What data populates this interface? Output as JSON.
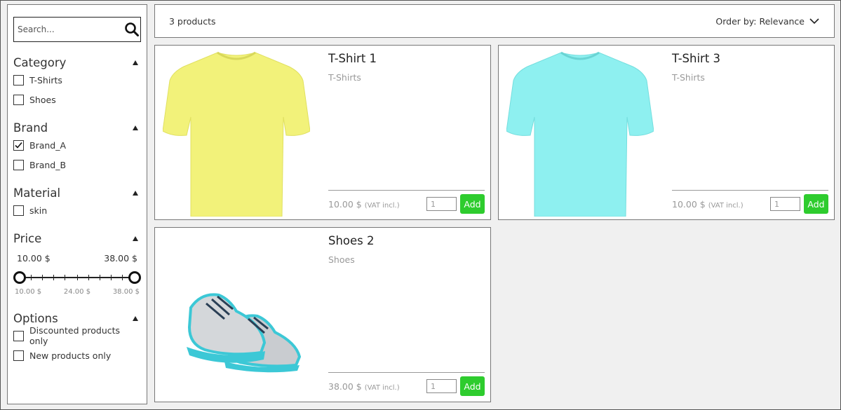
{
  "search": {
    "placeholder": "Search..."
  },
  "filters": {
    "category": {
      "title": "Category",
      "items": [
        {
          "label": "T-Shirts",
          "checked": false
        },
        {
          "label": "Shoes",
          "checked": false
        }
      ]
    },
    "brand": {
      "title": "Brand",
      "items": [
        {
          "label": "Brand_A",
          "checked": true
        },
        {
          "label": "Brand_B",
          "checked": false
        }
      ]
    },
    "material": {
      "title": "Material",
      "items": [
        {
          "label": "skin",
          "checked": false
        }
      ]
    },
    "price": {
      "title": "Price",
      "min_value": "10.00 $",
      "max_value": "38.00 $",
      "scale_min": "10.00 $",
      "scale_mid": "24.00 $",
      "scale_max": "38.00 $"
    },
    "options": {
      "title": "Options",
      "items": [
        {
          "label": "Discounted products only",
          "checked": false
        },
        {
          "label": "New products only",
          "checked": false
        }
      ]
    }
  },
  "toolbar": {
    "count": "3 products",
    "order_by": "Order by: Relevance"
  },
  "products": [
    {
      "title": "T-Shirt 1",
      "category": "T-Shirts",
      "price": "10.00 $",
      "vat": "(VAT incl.)",
      "qty": "1",
      "add_label": "Add",
      "image": "tshirt-image",
      "color": "#f2f27a"
    },
    {
      "title": "T-Shirt 3",
      "category": "T-Shirts",
      "price": "10.00 $",
      "vat": "(VAT incl.)",
      "qty": "1",
      "add_label": "Add",
      "image": "tshirt-image",
      "color": "#8ef0f0"
    },
    {
      "title": "Shoes 2",
      "category": "Shoes",
      "price": "38.00 $",
      "vat": "(VAT incl.)",
      "qty": "1",
      "add_label": "Add",
      "image": "shoes-image",
      "color": "#3cc8d6"
    }
  ]
}
